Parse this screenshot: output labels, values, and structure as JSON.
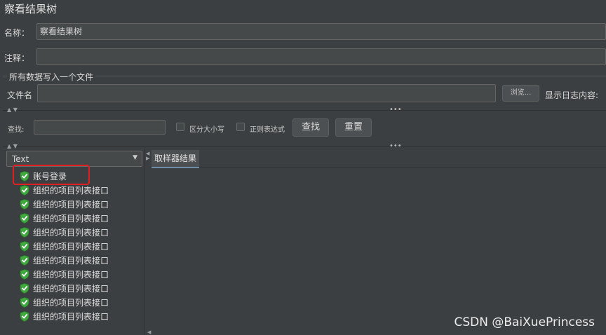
{
  "panel": {
    "title": "察看结果树",
    "name_label": "名称：",
    "name_value": "察看结果树",
    "comment_label": "注释：",
    "comment_value": ""
  },
  "file_section": {
    "legend": "所有数据写入一个文件",
    "filename_label": "文件名",
    "filename_value": "",
    "browse_label": "浏览...",
    "log_label": "显示日志内容:"
  },
  "search": {
    "label": "查找:",
    "value": "",
    "case_label": "区分大小写",
    "regex_label": "正则表达式",
    "find_button": "查找",
    "reset_button": "重置"
  },
  "tree": {
    "renderer": "Text",
    "items": [
      {
        "label": "账号登录",
        "status": "success",
        "highlighted": true
      },
      {
        "label": "组织的项目列表接口",
        "status": "success"
      },
      {
        "label": "组织的项目列表接口",
        "status": "success"
      },
      {
        "label": "组织的项目列表接口",
        "status": "success"
      },
      {
        "label": "组织的项目列表接口",
        "status": "success"
      },
      {
        "label": "组织的项目列表接口",
        "status": "success"
      },
      {
        "label": "组织的项目列表接口",
        "status": "success"
      },
      {
        "label": "组织的项目列表接口",
        "status": "success"
      },
      {
        "label": "组织的项目列表接口",
        "status": "success"
      },
      {
        "label": "组织的项目列表接口",
        "status": "success"
      },
      {
        "label": "组织的项目列表接口",
        "status": "success"
      }
    ]
  },
  "result_tabs": [
    {
      "label": "取样器结果",
      "active": true
    }
  ],
  "colors": {
    "background": "#3c3f41",
    "success_green": "#3fa83f",
    "highlight_red": "#e02020"
  },
  "watermark": "CSDN @BaiXuePrincess"
}
